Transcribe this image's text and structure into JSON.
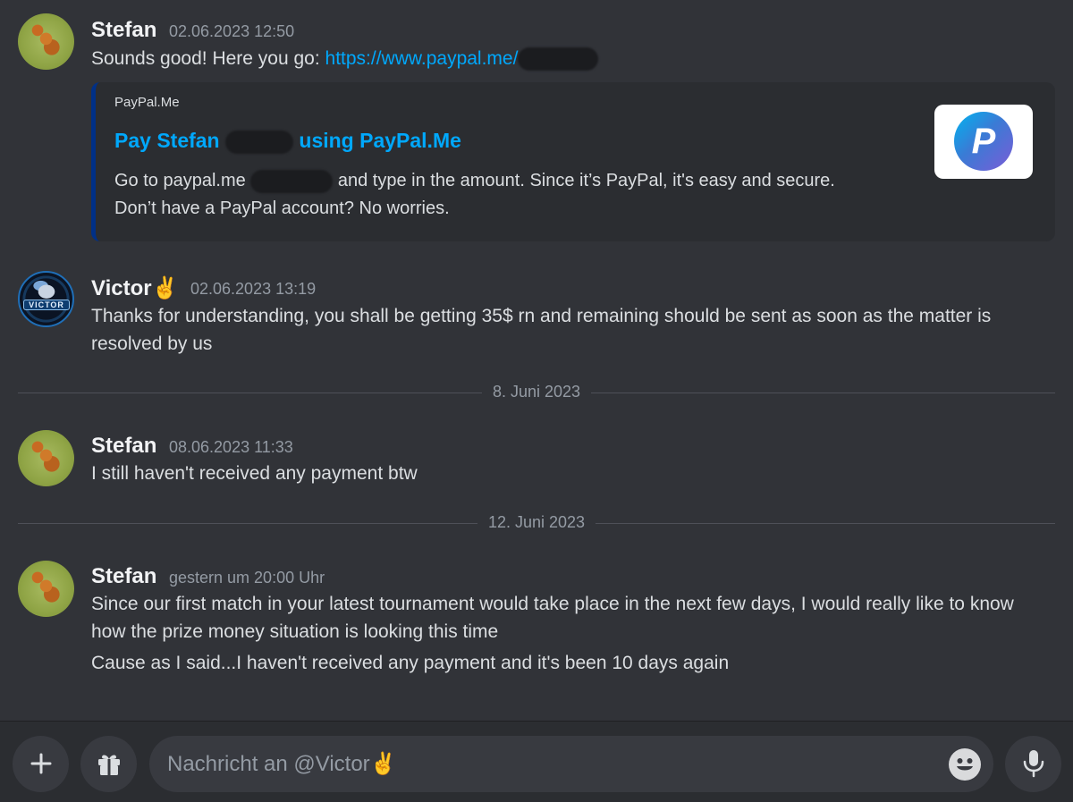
{
  "messages": [
    {
      "author": "Stefan",
      "time": "02.06.2023 12:50",
      "text_prefix": "Sounds good! Here you go: ",
      "link": "https://www.paypal.me/",
      "embed": {
        "provider": "PayPal.Me",
        "title_start": "Pay Stefan",
        "title_end": "using PayPal.Me",
        "desc_start": "Go to paypal.me",
        "desc_end": "and type in the amount. Since it’s PayPal, it's easy and secure.",
        "desc_line2": "Don’t have a PayPal account? No worries.",
        "thumb_icon": "paypal-logo-icon"
      }
    },
    {
      "author": "Victor✌️",
      "time": "02.06.2023 13:19",
      "line1": "Thanks for understanding, you shall be getting 35$ rn and remaining should be sent  as soon as the matter is",
      "line2": "resolved by us",
      "avatar_text": "VICTOR"
    },
    {
      "author": "Stefan",
      "time": "08.06.2023 11:33",
      "line1": "I still haven't received any payment btw"
    },
    {
      "author": "Stefan",
      "time": "gestern um 20:00 Uhr",
      "line1": "Since our first match in your latest tournament would take place in the next few days, I would really like to know",
      "line2": "how the prize money situation is looking this time",
      "line3": "Cause as I said...I haven't received any payment and it's been 10 days again"
    }
  ],
  "dividers": [
    "8. Juni 2023",
    "12. Juni 2023"
  ],
  "composer": {
    "placeholder": "Nachricht an @Victor✌️",
    "add_icon": "plus-icon",
    "gift_icon": "gift-icon",
    "emoji_icon": "smiley-icon",
    "mic_icon": "microphone-icon"
  },
  "colors": {
    "background": "#313338",
    "link": "#00a8fc",
    "embed_border": "#003087"
  }
}
